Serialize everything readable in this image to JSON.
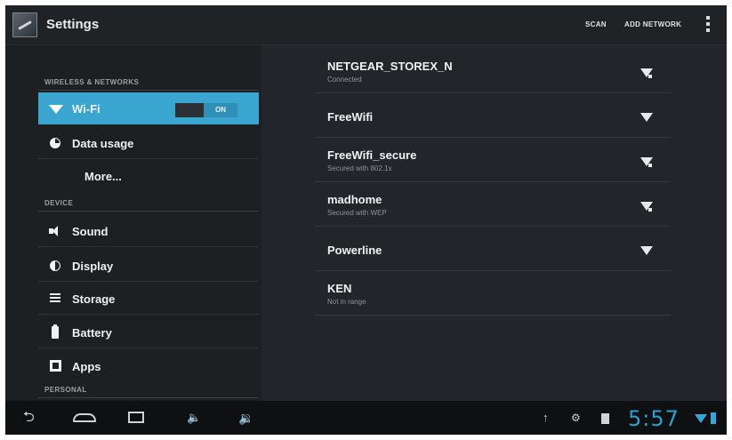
{
  "actionbar": {
    "title": "Settings",
    "scan_label": "SCAN",
    "add_network_label": "ADD NETWORK",
    "app_icon": "settings-icon",
    "overflow_icon": "overflow-menu-icon"
  },
  "sidebar": {
    "sections": {
      "wireless": "WIRELESS & NETWORKS",
      "device": "DEVICE",
      "personal": "PERSONAL"
    },
    "items": [
      {
        "label": "Wi-Fi",
        "icon": "wifi-icon",
        "toggle": "ON",
        "selected": true
      },
      {
        "label": "Data usage",
        "icon": "data-usage-icon"
      },
      {
        "label": "More...",
        "icon": ""
      },
      {
        "label": "Sound",
        "icon": "sound-icon"
      },
      {
        "label": "Display",
        "icon": "display-icon"
      },
      {
        "label": "Storage",
        "icon": "storage-icon"
      },
      {
        "label": "Battery",
        "icon": "battery-icon"
      },
      {
        "label": "Apps",
        "icon": "apps-icon"
      }
    ],
    "accent": "#3aa6cf"
  },
  "networks": [
    {
      "ssid": "NETGEAR_STOREX_N",
      "status": "Connected",
      "secured": true
    },
    {
      "ssid": "FreeWifi",
      "status": "",
      "secured": false
    },
    {
      "ssid": "FreeWifi_secure",
      "status": "Secured with 802.1x",
      "secured": true
    },
    {
      "ssid": "madhome",
      "status": "Secured with WEP",
      "secured": true
    },
    {
      "ssid": "Powerline",
      "status": "",
      "secured": false
    },
    {
      "ssid": "KEN",
      "status": "Not in range",
      "secured": false
    }
  ],
  "statusbar": {
    "time": "5:57",
    "icons": [
      "back-icon",
      "home-icon",
      "recents-icon",
      "volume-down-icon",
      "volume-up-icon",
      "usb-icon",
      "debug-icon",
      "sd-card-icon",
      "wifi-signal-icon",
      "battery-icon"
    ]
  }
}
